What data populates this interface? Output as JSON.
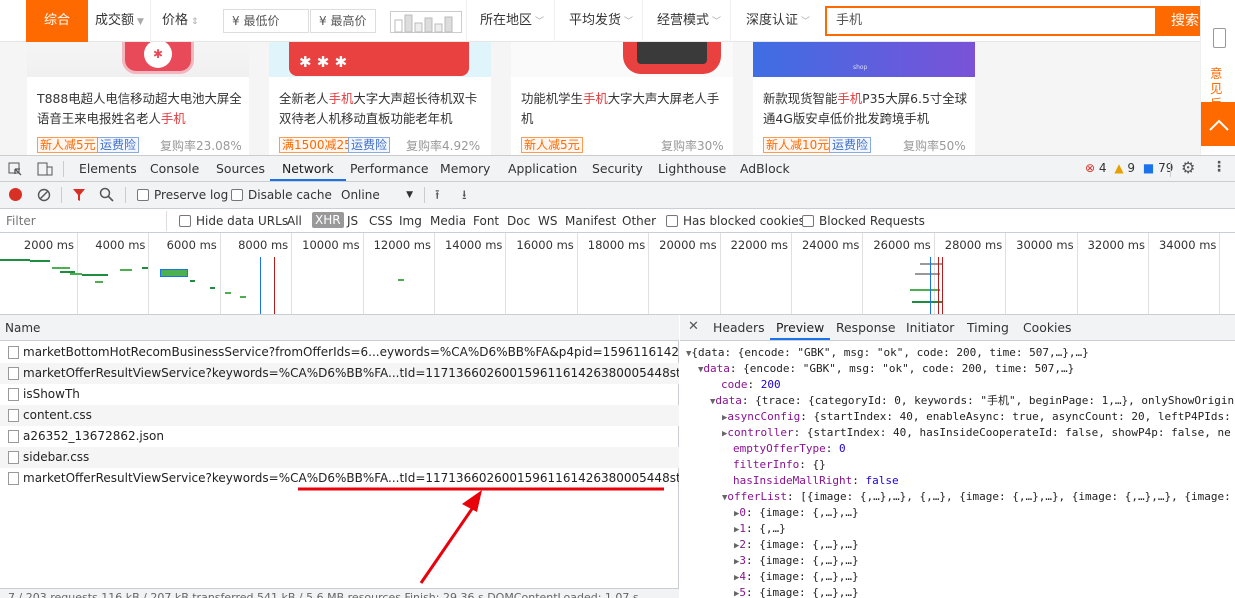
{
  "filterbar": {
    "zonghe": "综合",
    "volume": "成交额",
    "price": "价格",
    "min_price_placeholder": "¥ 最低价",
    "dash": "—",
    "max_price_placeholder": "¥ 最高价",
    "region": "所在地区",
    "shipping": "平均发货",
    "biz_mode": "经营模式",
    "certification": "深度认证",
    "search_value": "手机",
    "search_button": "搜索"
  },
  "side": {
    "feedback": "意见反馈"
  },
  "products": [
    {
      "title_pre": "T888电超人电信移动超大电池大屏全语音王来电报姓名老人",
      "title_hl": "手机",
      "title_post": "",
      "tag1": "新人减5元",
      "tag2": "运费险",
      "rate": "复购率23.08%"
    },
    {
      "title_pre": "全新老人",
      "title_hl": "手机",
      "title_post": "大字大声超长待机双卡双待老人机移动直板功能老年机",
      "tag1": "满1500减25",
      "tag2": "运费险",
      "rate": "复购率4.92%"
    },
    {
      "title_pre": "功能机学生",
      "title_hl": "手机",
      "title_post": "大字大声大屏老人手机",
      "tag1": "新人减5元",
      "tag2": "",
      "rate": "复购率30%"
    },
    {
      "title_pre": "新款现货智能",
      "title_hl": "手机",
      "title_post": "P35大屏6.5寸全球通4G版安卓低价批发跨境手机",
      "tag1": "新人减10元",
      "tag2": "运费险",
      "rate": "复购率50%"
    }
  ],
  "devtools": {
    "tabs": [
      "Elements",
      "Console",
      "Sources",
      "Network",
      "Performance",
      "Memory",
      "Application",
      "Security",
      "Lighthouse",
      "AdBlock"
    ],
    "active_tab": "Network",
    "errors": "4",
    "warnings": "9",
    "messages": "79",
    "preserve_log": "Preserve log",
    "disable_cache": "Disable cache",
    "throttle": "Online",
    "filter_placeholder": "Filter",
    "hide_data_urls": "Hide data URLs",
    "types": [
      "All",
      "XHR",
      "JS",
      "CSS",
      "Img",
      "Media",
      "Font",
      "Doc",
      "WS",
      "Manifest",
      "Other"
    ],
    "active_type": "XHR",
    "has_blocked_cookies": "Has blocked cookies",
    "blocked_requests": "Blocked Requests",
    "timeline_ticks": [
      "2000 ms",
      "4000 ms",
      "6000 ms",
      "8000 ms",
      "10000 ms",
      "12000 ms",
      "14000 ms",
      "16000 ms",
      "18000 ms",
      "20000 ms",
      "22000 ms",
      "24000 ms",
      "26000 ms",
      "28000 ms",
      "30000 ms",
      "32000 ms",
      "34000 ms",
      "3600"
    ],
    "name_header": "Name",
    "requests": [
      "marketBottomHotRecomBusinessService?fromOfferIds=6...eywords=%CA%D6%BB%FA&p4pid=1596116142667206168378",
      "marketOfferResultViewService?keywords=%CA%D6%BB%FA...tId=11713660260015961161426380005448startIndex=20",
      "isShowTh",
      "content.css",
      "a26352_13672862.json",
      "sidebar.css",
      "marketOfferResultViewService?keywords=%CA%D6%BB%FA...tId=11713660260015961161426380005448startIndex=40"
    ],
    "detail_tabs": [
      "Headers",
      "Preview",
      "Response",
      "Initiator",
      "Timing",
      "Cookies"
    ],
    "active_detail_tab": "Preview",
    "preview": {
      "l1": "{data: {encode: \"GBK\", msg: \"ok\", code: 200, time: 507,…},…}",
      "l2_key": "data",
      "l2": "{encode: \"GBK\", msg: \"ok\", code: 200, time: 507,…}",
      "l3_key": "code",
      "l3": "200",
      "l4_key": "data",
      "l4": "{trace: {categoryId: 0, keywords: \"手机\", beginPage: 1,…}, onlyShowOrigin",
      "l5_key": "asyncConfig",
      "l5": "{startIndex: 40, enableAsync: true, asyncCount: 20, leftP4PIds:",
      "l6_key": "controller",
      "l6": "{startIndex: 40, hasInsideCooperateId: false, showP4p: false, ne",
      "l7_key": "emptyOfferType",
      "l7": "0",
      "l8_key": "filterInfo",
      "l8": "{}",
      "l9_key": "hasInsideMallRight",
      "l9": "false",
      "l10_key": "offerList",
      "l10": "[{image: {,…},…}, {,…}, {image: {,…},…}, {image: {,…},…}, {image:",
      "items": [
        {
          "k": "0",
          "v": "{image: {,…},…}"
        },
        {
          "k": "1",
          "v": "{,…}"
        },
        {
          "k": "2",
          "v": "{image: {,…},…}"
        },
        {
          "k": "3",
          "v": "{image: {,…},…}"
        },
        {
          "k": "4",
          "v": "{image: {,…},…}"
        },
        {
          "k": "5",
          "v": "{image: {,…},…}"
        }
      ]
    },
    "status_bar": "7 / 203 requests   116 kB / 207 kB transferred   541 kB / 5.6 MB resources   Finish: 29.36 s   DOMContentLoaded: 1.07 s"
  },
  "colors": {
    "brand": "#ff6a00",
    "annotation": "#e8000b",
    "devtools_accent": "#1a73e8"
  }
}
